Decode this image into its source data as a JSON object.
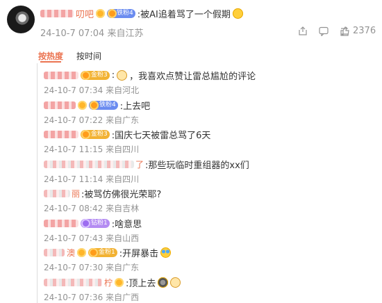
{
  "post": {
    "username_visible": "叨吧",
    "badge": "铁粉4",
    "text": ":被AI追着骂了一个假期",
    "time": "24-10-7 07:04",
    "location": "来自江苏",
    "like_count": "2376"
  },
  "tabs": [
    {
      "label": "按热度",
      "active": true
    },
    {
      "label": "按时间",
      "active": false
    }
  ],
  "comments": [
    {
      "badge": "金粉3",
      "badge_color": "gold",
      "text": "，我喜欢点赞让雷总尴尬的评论",
      "time": "24-10-7 07:34",
      "location": "来自河北"
    },
    {
      "badge": "铁粉4",
      "badge_color": "blue",
      "text": ":上去吧",
      "time": "24-10-7 07:22",
      "location": "来自广东"
    },
    {
      "badge": "金粉3",
      "badge_color": "gold",
      "text": ":国庆七天被雷总骂了6天",
      "time": "24-10-7 11:15",
      "location": "来自四川"
    },
    {
      "name_tail": "了",
      "text": ":那些玩临时重组器的xx们",
      "time": "24-10-7 11:14",
      "location": "来自四川"
    },
    {
      "name_tail": "丽",
      "text": ":被骂仿佛很光荣耶?",
      "time": "24-10-7 08:42",
      "location": "来自吉林"
    },
    {
      "badge": "钻粉1",
      "badge_color": "purple",
      "text": ":啥意思",
      "time": "24-10-7 07:43",
      "location": "来自山西"
    },
    {
      "name_tail": "澳",
      "badge": "金粉1",
      "badge_color": "gold",
      "text": ":开屏暴击",
      "time": "24-10-7 07:30",
      "location": "来自广东"
    },
    {
      "name_tail": "柠",
      "text": ":顶上去",
      "time": "24-10-7 07:36",
      "location": "来自广西"
    }
  ],
  "colors": {
    "accent": "#eb7350",
    "meta": "#939393",
    "thread": "#dcdcdc"
  },
  "icons": [
    "share-icon",
    "comment-icon",
    "repost-icon",
    "like-icon",
    "cat-badge-icon",
    "emoji-icon"
  ]
}
